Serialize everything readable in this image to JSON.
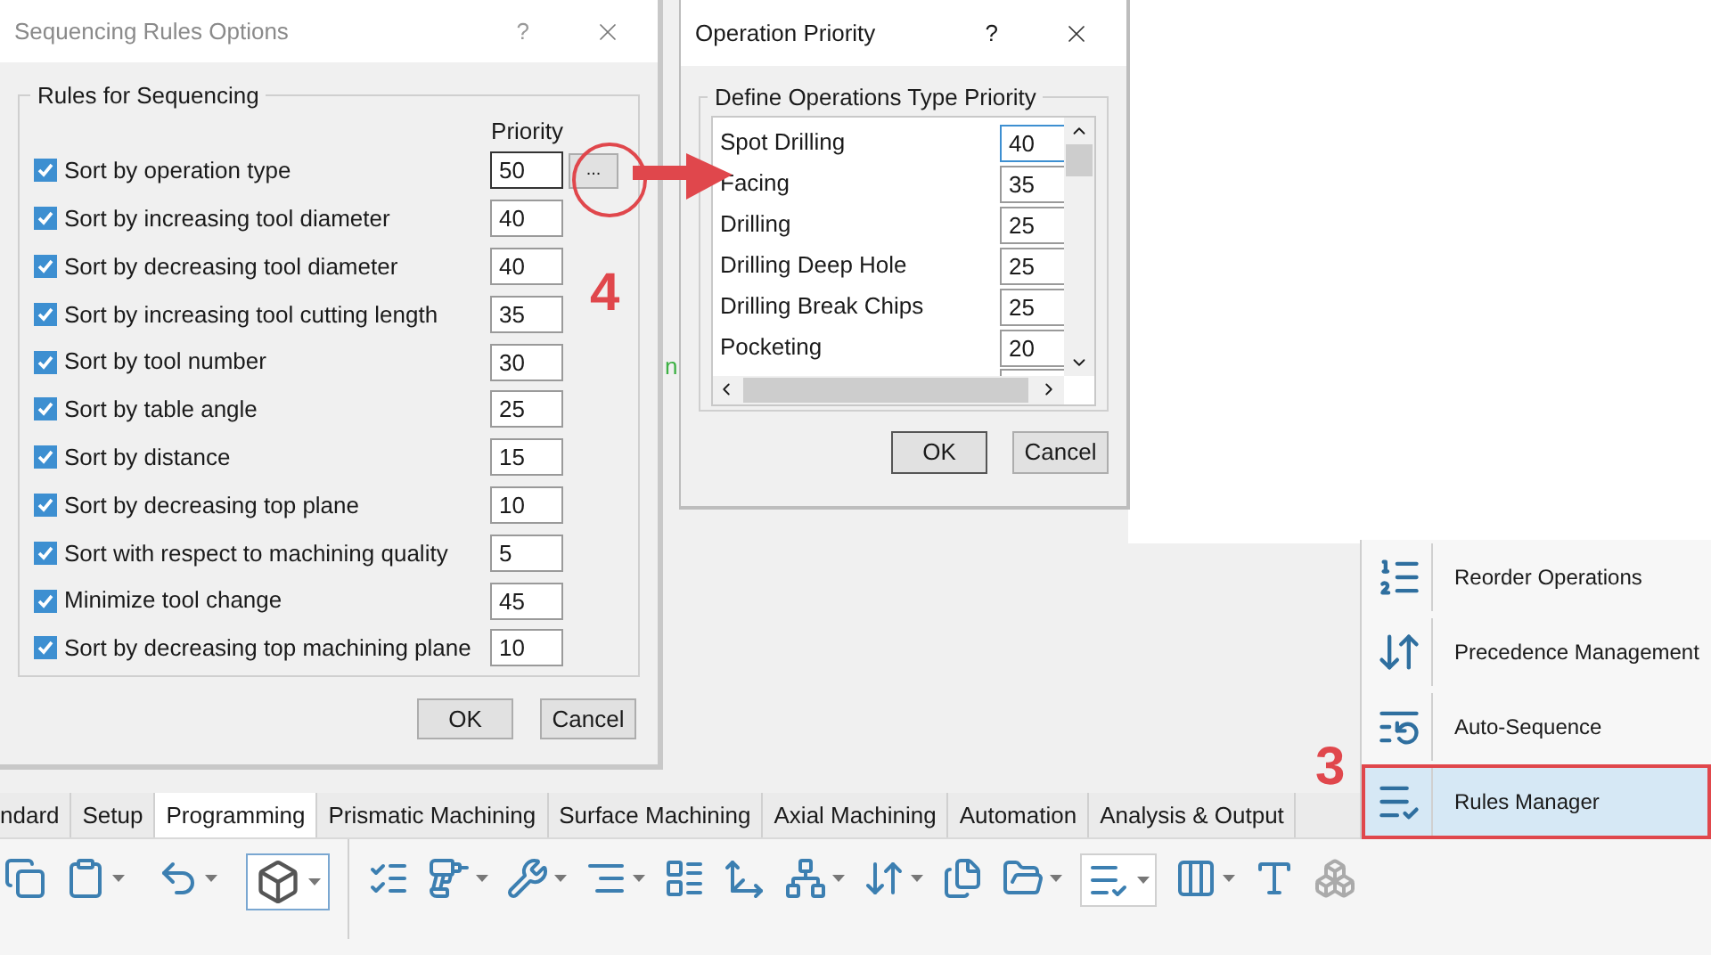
{
  "rules_dialog": {
    "title": "Sequencing Rules Options",
    "help": "?",
    "group_title": "Rules for Sequencing",
    "priority_header": "Priority",
    "details_button": "...",
    "rules": [
      {
        "label": "Sort by operation type",
        "checked": true,
        "priority": "50"
      },
      {
        "label": "Sort by increasing tool diameter",
        "checked": true,
        "priority": "40"
      },
      {
        "label": "Sort by decreasing tool diameter",
        "checked": true,
        "priority": "40"
      },
      {
        "label": "Sort by increasing tool cutting length",
        "checked": true,
        "priority": "35"
      },
      {
        "label": "Sort by tool number",
        "checked": true,
        "priority": "30"
      },
      {
        "label": "Sort by table angle",
        "checked": true,
        "priority": "25"
      },
      {
        "label": "Sort by distance",
        "checked": true,
        "priority": "15"
      },
      {
        "label": "Sort by decreasing top plane",
        "checked": true,
        "priority": "10"
      },
      {
        "label": "Sort with respect to machining quality",
        "checked": true,
        "priority": "5"
      },
      {
        "label": "Minimize tool change",
        "checked": true,
        "priority": "45"
      },
      {
        "label": "Sort by decreasing top machining plane",
        "checked": true,
        "priority": "10"
      }
    ],
    "buttons": [
      "OK",
      "Cancel"
    ]
  },
  "priority_dialog": {
    "title": "Operation Priority",
    "help": "?",
    "group_title": "Define Operations Type Priority",
    "operations": [
      {
        "name": "Spot Drilling",
        "priority": "40",
        "focused": true
      },
      {
        "name": "Facing",
        "priority": "35",
        "focused": false
      },
      {
        "name": "Drilling",
        "priority": "25",
        "focused": false
      },
      {
        "name": "Drilling Deep Hole",
        "priority": "25",
        "focused": false
      },
      {
        "name": "Drilling Break Chips",
        "priority": "25",
        "focused": false
      },
      {
        "name": "Pocketing",
        "priority": "20",
        "focused": false
      }
    ],
    "buttons": [
      "OK",
      "Cancel"
    ]
  },
  "background_fragment": "n",
  "callouts": [
    {
      "text": "4"
    },
    {
      "text": "3"
    }
  ],
  "dropdown_menu": {
    "items": [
      {
        "label": "Reorder Operations",
        "kind": "reorder",
        "selected": false
      },
      {
        "label": "Precedence Management",
        "kind": "precedence",
        "selected": false
      },
      {
        "label": "Auto-Sequence",
        "kind": "auto",
        "selected": false
      },
      {
        "label": "Rules Manager",
        "kind": "rules",
        "selected": true
      }
    ]
  },
  "ribbon": {
    "tabs": [
      {
        "label": "ndard",
        "selected": false
      },
      {
        "label": "Setup",
        "selected": false
      },
      {
        "label": "Programming",
        "selected": true
      },
      {
        "label": "Prismatic Machining",
        "selected": false
      },
      {
        "label": "Surface Machining",
        "selected": false
      },
      {
        "label": "Axial Machining",
        "selected": false
      },
      {
        "label": "Automation",
        "selected": false
      },
      {
        "label": "Analysis & Output",
        "selected": false
      }
    ]
  }
}
